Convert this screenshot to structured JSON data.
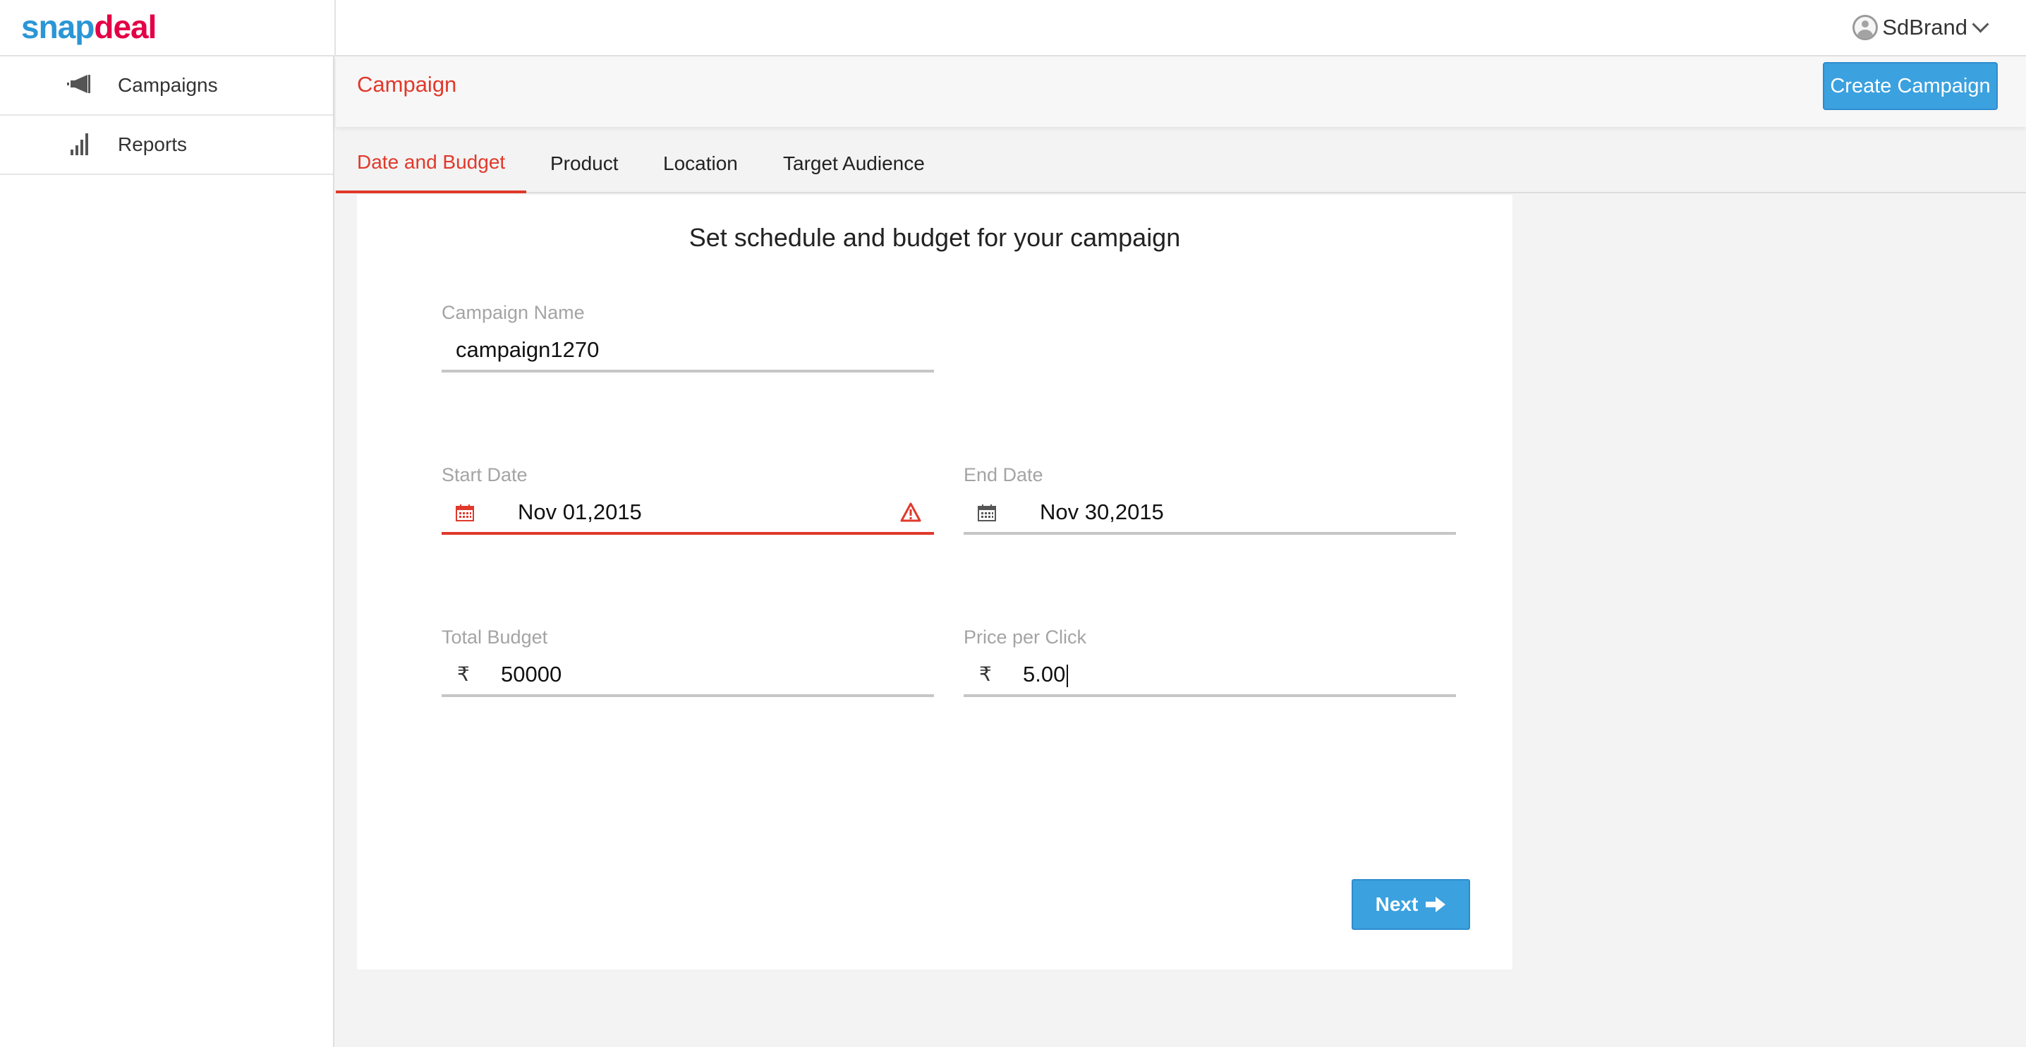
{
  "brand": {
    "logo_snap": "snap",
    "logo_deal": "deal",
    "snap_color": "#2a96d6",
    "deal_color": "#e40046"
  },
  "user": {
    "name": "SdBrand",
    "icon": "user-avatar-icon",
    "menu_icon": "chevron-down-icon"
  },
  "sidebar": {
    "items": [
      {
        "label": "Campaigns",
        "icon": "megaphone-icon"
      },
      {
        "label": "Reports",
        "icon": "bar-chart-icon"
      }
    ]
  },
  "header": {
    "title": "Campaign",
    "create_button": "Create Campaign"
  },
  "tabs": [
    {
      "label": "Date and Budget",
      "active": true
    },
    {
      "label": "Product",
      "active": false
    },
    {
      "label": "Location",
      "active": false
    },
    {
      "label": "Target Audience",
      "active": false
    }
  ],
  "form": {
    "heading": "Set schedule and budget for your campaign",
    "campaign_name": {
      "label": "Campaign Name",
      "value": "campaign1270"
    },
    "start_date": {
      "label": "Start Date",
      "value": "Nov 01,2015",
      "error": true,
      "icon": "calendar-icon"
    },
    "end_date": {
      "label": "End Date",
      "value": "Nov 30,2015",
      "icon": "calendar-icon"
    },
    "total_budget": {
      "label": "Total Budget",
      "currency": "₹",
      "value": "50000"
    },
    "price_per_click": {
      "label": "Price per Click",
      "currency": "₹",
      "value": "5.00"
    },
    "next_button": "Next"
  },
  "colors": {
    "accent_red": "#e0392b",
    "button_blue": "#3ba1df"
  }
}
